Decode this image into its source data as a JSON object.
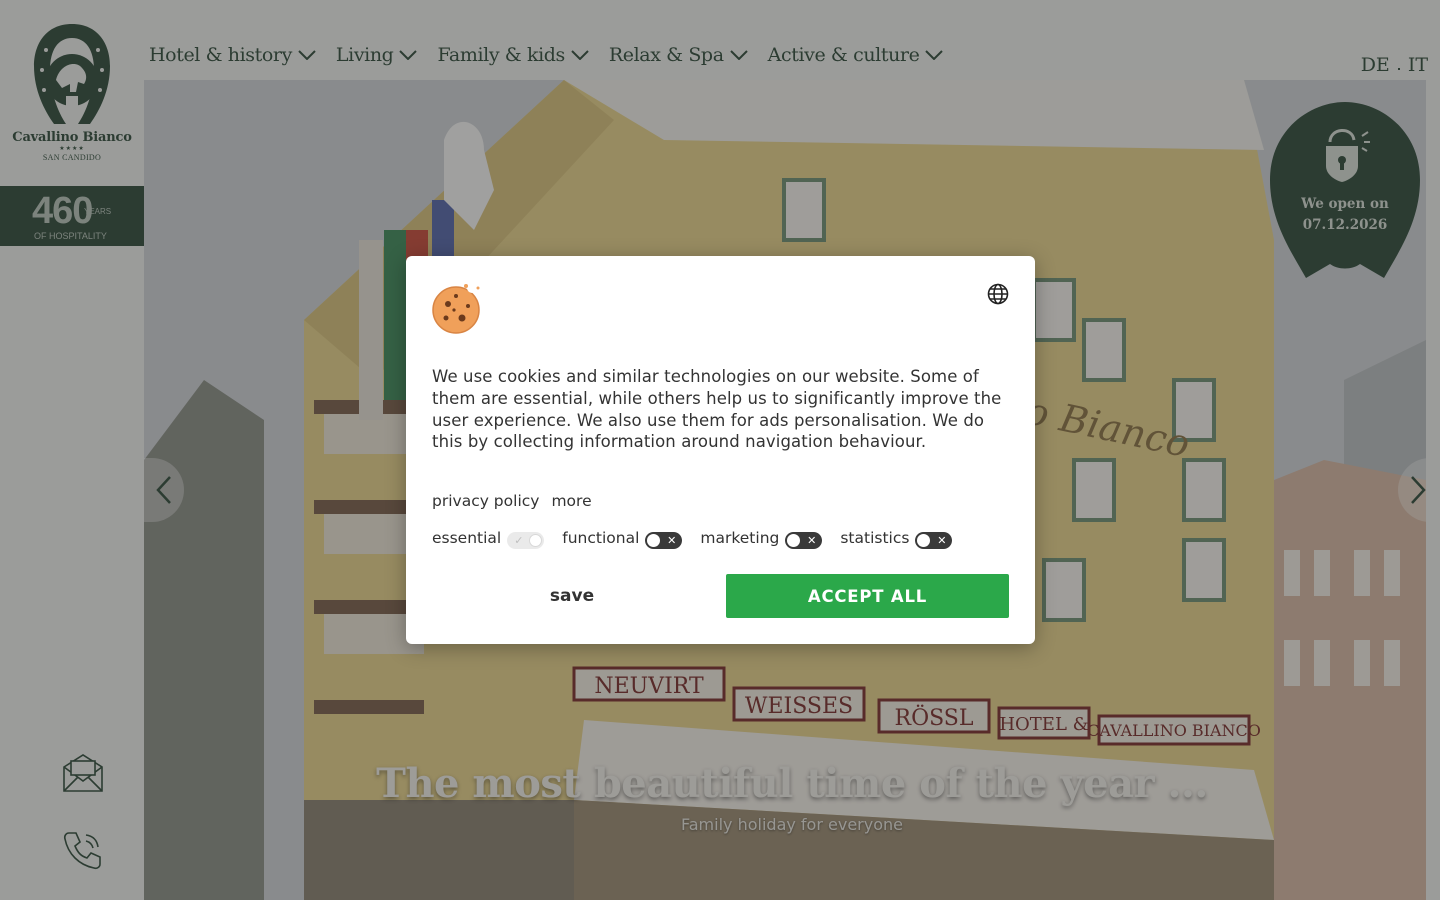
{
  "brand": {
    "name": "Cavallino Bianco",
    "stars": "★★★★",
    "location": "SAN CANDIDO",
    "anniversary_number": "460",
    "anniversary_unit": "YEARS",
    "anniversary_sub": "OF HOSPITALITY"
  },
  "nav": {
    "items": [
      {
        "label": "Hotel & history"
      },
      {
        "label": "Living"
      },
      {
        "label": "Family & kids"
      },
      {
        "label": "Relax & Spa"
      },
      {
        "label": "Active & culture"
      }
    ],
    "languages": [
      "DE",
      "IT"
    ]
  },
  "sidebar": {
    "icons": [
      "mail-icon",
      "phone-icon"
    ]
  },
  "hero": {
    "title": "The most beautiful time of the year ...",
    "subtitle": "Family holiday for everyone",
    "badge_line1": "We open on",
    "badge_line2": "07.12.2026"
  },
  "cookie_dialog": {
    "text": "We use cookies and similar technologies on our website. Some of them are essential, while others help us to significantly improve the user experience. We also use them for ads personalisation. We do this by collecting information around navigation behaviour.",
    "privacy_link": "privacy policy",
    "more_link": "more",
    "toggles": [
      {
        "label": "essential",
        "state": "on",
        "disabled": true
      },
      {
        "label": "functional",
        "state": "off"
      },
      {
        "label": "marketing",
        "state": "off"
      },
      {
        "label": "statistics",
        "state": "off"
      }
    ],
    "save_label": "save",
    "accept_label": "ACCEPT ALL",
    "accept_color": "#2ba84a"
  },
  "colors": {
    "brand_green": "#2f4b3a",
    "overlay": "rgba(40,40,40,0.42)"
  }
}
